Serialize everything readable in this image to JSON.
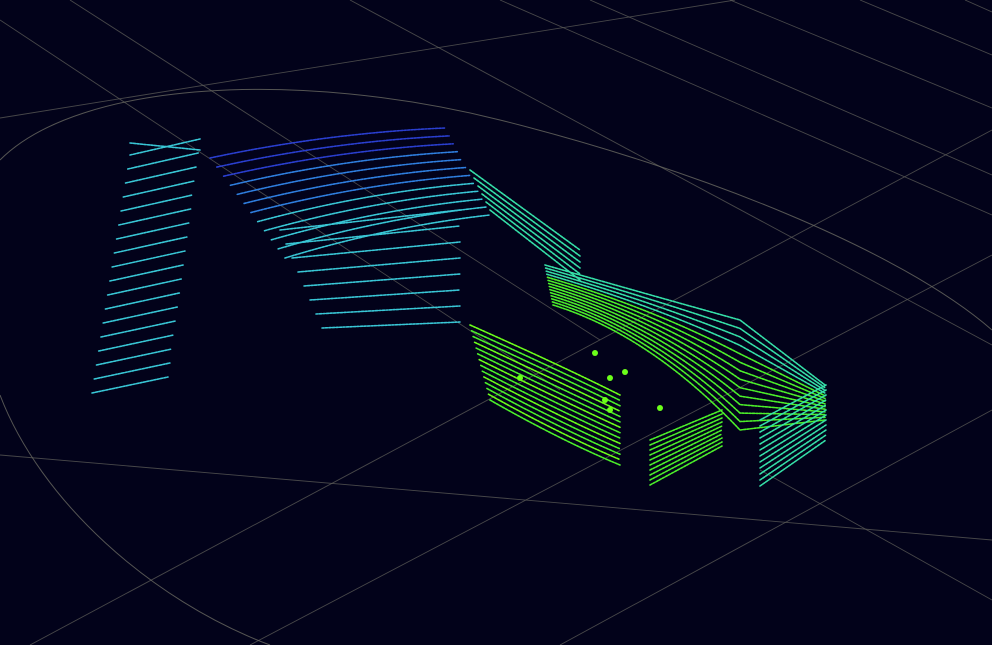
{
  "viewer": {
    "background_color": "#02021a",
    "grid_color": "#5f5f5a",
    "colormap": [
      "#2a3fd0",
      "#2f7fe0",
      "#39c7d6",
      "#35e0a8",
      "#4cf02a",
      "#6cff1a"
    ]
  },
  "scene": {
    "description_visible_text": ""
  }
}
